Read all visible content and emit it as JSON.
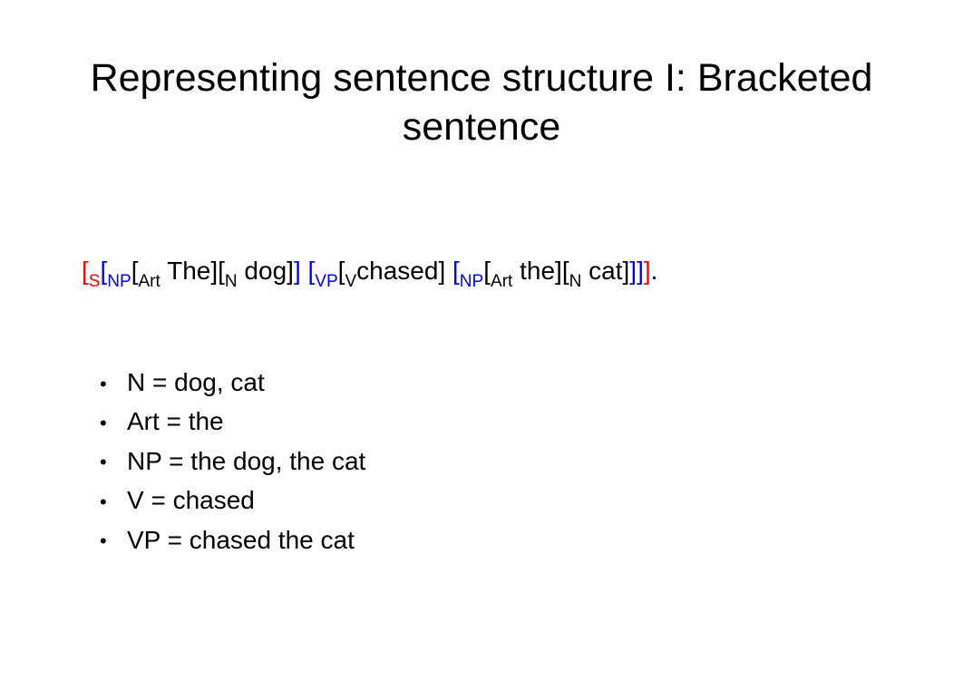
{
  "title": "Representing sentence structure I: Bracketed sentence",
  "tokens": [
    {
      "t": "[",
      "c": "br-red"
    },
    {
      "t": "S",
      "c": "br-red sub"
    },
    {
      "t": "[",
      "c": "br-blue"
    },
    {
      "t": "NP",
      "c": "br-blue sub"
    },
    {
      "t": "["
    },
    {
      "t": "Art",
      "c": "sub"
    },
    {
      "t": " The]["
    },
    {
      "t": "N",
      "c": "sub"
    },
    {
      "t": " dog]"
    },
    {
      "t": "]",
      "c": "br-blue"
    },
    {
      "t": " ",
      "c": ""
    },
    {
      "t": "[",
      "c": "br-blue"
    },
    {
      "t": "VP",
      "c": "br-blue sub"
    },
    {
      "t": "["
    },
    {
      "t": "V",
      "c": "sub"
    },
    {
      "t": "chased] "
    },
    {
      "t": "[",
      "c": "br-blue"
    },
    {
      "t": "NP",
      "c": "br-blue sub"
    },
    {
      "t": "["
    },
    {
      "t": "Art",
      "c": "sub"
    },
    {
      "t": " the]["
    },
    {
      "t": "N",
      "c": "sub"
    },
    {
      "t": " cat]"
    },
    {
      "t": "]",
      "c": "br-blue"
    },
    {
      "t": "]",
      "c": "br-blue"
    },
    {
      "t": "]",
      "c": "br-red"
    },
    {
      "t": "."
    }
  ],
  "bullets": [
    "N = dog, cat",
    "Art = the",
    "NP = the dog, the cat",
    "V = chased",
    "VP = chased the cat"
  ]
}
